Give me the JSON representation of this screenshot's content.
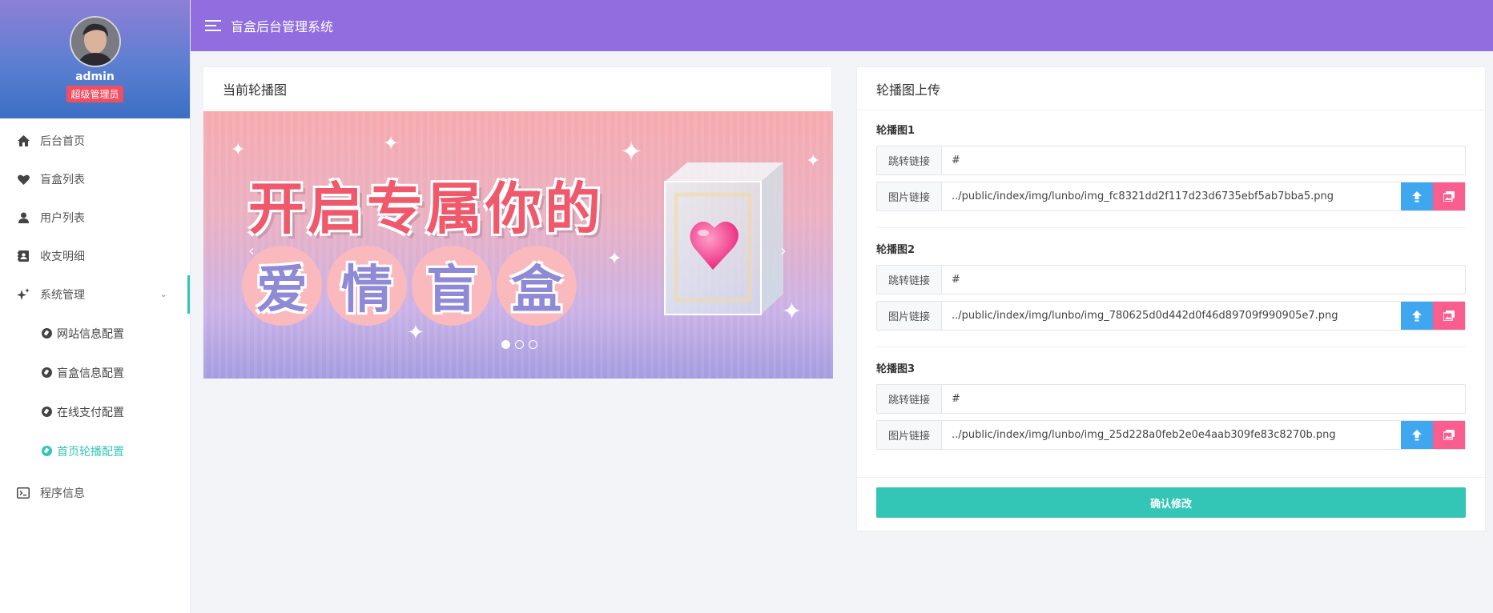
{
  "header": {
    "title": "盲盒后台管理系统"
  },
  "sidebar": {
    "user": {
      "name": "admin",
      "role": "超级管理员"
    },
    "items": [
      {
        "label": "后台首页",
        "icon": "home-icon"
      },
      {
        "label": "盲盒列表",
        "icon": "heart-icon"
      },
      {
        "label": "用户列表",
        "icon": "user-icon"
      },
      {
        "label": "收支明细",
        "icon": "contact-book-icon"
      },
      {
        "label": "系统管理",
        "icon": "sparkle-icon"
      },
      {
        "label": "程序信息",
        "icon": "terminal-icon"
      }
    ],
    "sub_items": [
      {
        "label": "网站信息配置"
      },
      {
        "label": "盲盒信息配置"
      },
      {
        "label": "在线支付配置"
      },
      {
        "label": "首页轮播配置"
      }
    ]
  },
  "current_carousel": {
    "title": "当前轮播图",
    "banner": {
      "line1": "开启专属你的",
      "line2": [
        "爱",
        "情",
        "盲",
        "盒"
      ],
      "prev": "‹",
      "next": "›"
    }
  },
  "upload": {
    "title": "轮播图上传",
    "link_label": "跳转链接",
    "image_label": "图片链接",
    "groups": [
      {
        "title": "轮播图1",
        "link": "#",
        "image": "../public/index/img/lunbo/img_fc8321dd2f117d23d6735ebf5ab7bba5.png"
      },
      {
        "title": "轮播图2",
        "link": "#",
        "image": "../public/index/img/lunbo/img_780625d0d442d0f46d89709f990905e7.png"
      },
      {
        "title": "轮播图3",
        "link": "#",
        "image": "../public/index/img/lunbo/img_25d228a0feb2e0e4aab309fe83c8270b.png"
      }
    ],
    "submit_label": "确认修改"
  },
  "colors": {
    "header": "#916ddf",
    "accent": "#33c6b6",
    "upload_button": "#3fa7f0",
    "browse_button": "#f95e8e",
    "role_badge": "#f04e62"
  }
}
